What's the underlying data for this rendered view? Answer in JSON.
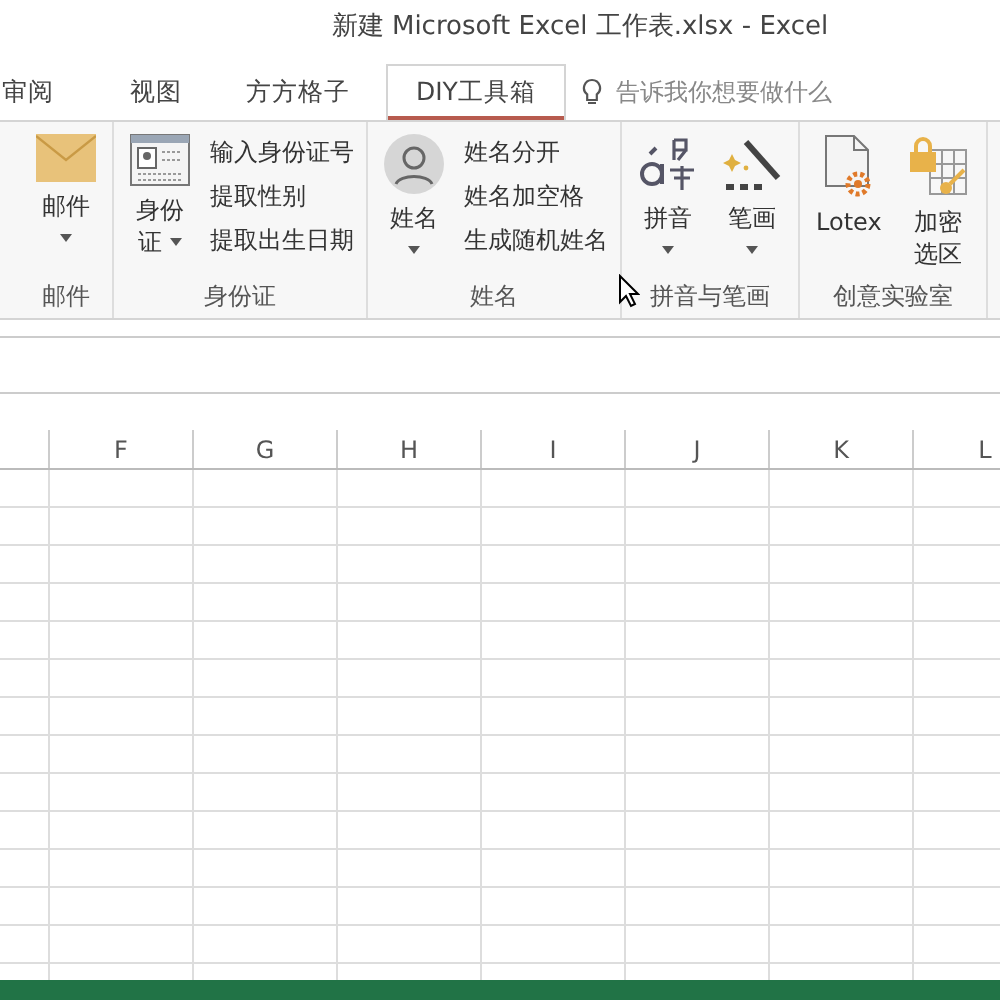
{
  "window": {
    "title": "新建 Microsoft Excel 工作表.xlsx - Excel"
  },
  "tabs": [
    {
      "label": "审阅",
      "selected": false
    },
    {
      "label": "视图",
      "selected": false
    },
    {
      "label": "方方格子",
      "selected": false
    },
    {
      "label": "DIY工具箱",
      "selected": true
    }
  ],
  "tell_me": {
    "placeholder": "告诉我你想要做什么"
  },
  "ribbon": {
    "groups": [
      {
        "label": "邮件",
        "buttons": [
          {
            "kind": "large",
            "lines": [
              "邮件"
            ],
            "dropdown": true
          }
        ]
      },
      {
        "label": "身份证",
        "buttons": [
          {
            "kind": "large",
            "lines": [
              "身份",
              "证"
            ],
            "dropdown": true
          },
          {
            "kind": "small",
            "items": [
              "输入身份证号",
              "提取性别",
              "提取出生日期"
            ]
          }
        ]
      },
      {
        "label": "姓名",
        "buttons": [
          {
            "kind": "large",
            "lines": [
              "姓名"
            ],
            "dropdown": true
          },
          {
            "kind": "small",
            "items": [
              "姓名分开",
              "姓名加空格",
              "生成随机姓名"
            ]
          }
        ]
      },
      {
        "label": "拼音与笔画",
        "buttons": [
          {
            "kind": "large",
            "lines": [
              "拼音"
            ],
            "dropdown": true
          },
          {
            "kind": "large",
            "lines": [
              "笔画"
            ],
            "dropdown": true
          }
        ]
      },
      {
        "label": "创意实验室",
        "buttons": [
          {
            "kind": "large",
            "lines": [
              "Lotex"
            ],
            "dropdown": false
          },
          {
            "kind": "large",
            "lines": [
              "加密",
              "选区"
            ],
            "dropdown": false
          }
        ]
      }
    ]
  },
  "sheet": {
    "columns": [
      "F",
      "G",
      "H",
      "I",
      "J",
      "K",
      "L"
    ]
  }
}
